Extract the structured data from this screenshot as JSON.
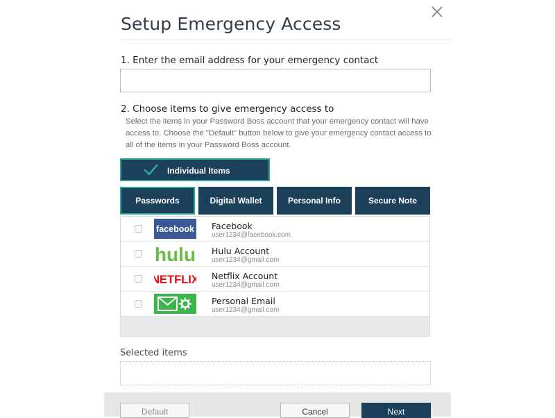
{
  "dialog": {
    "title": "Setup Emergency Access",
    "close_icon": "close-icon"
  },
  "step1": {
    "label": "1. Enter the email address for your emergency contact",
    "email_value": "",
    "email_placeholder": ""
  },
  "step2": {
    "label": "2. Choose items to give emergency access to",
    "description": "Select the items in your Password Boss account that your emergency contact will have access to. Choose the \"Default\" button below to give your emergency contact access to all of the items in your Password Boss account."
  },
  "mode": {
    "label": "Individual Items",
    "icon": "checkmark-icon",
    "selected": true
  },
  "tabs": [
    {
      "label": "Passwords",
      "active": true
    },
    {
      "label": "Digital Wallet",
      "active": false
    },
    {
      "label": "Personal Info",
      "active": false
    },
    {
      "label": "Secure Note",
      "active": false
    }
  ],
  "items": [
    {
      "name": "Facebook",
      "account": "user1234@facebook.com",
      "logo": "facebook",
      "checked": false
    },
    {
      "name": "Hulu Account",
      "account": "user1234@gmail.com",
      "logo": "hulu",
      "checked": false
    },
    {
      "name": "Netflix Account",
      "account": "user1234@gmail.com",
      "logo": "NETFLIX",
      "checked": false
    },
    {
      "name": "Personal Email",
      "account": "user1234@gmail.com",
      "logo": "email-icon",
      "checked": false
    }
  ],
  "selected_items": {
    "label": "Selected items",
    "value": ""
  },
  "footer": {
    "default_label": "Default",
    "cancel_label": "Cancel",
    "next_label": "Next"
  },
  "colors": {
    "primary": "#1c3f5a",
    "accent": "#2aa99b",
    "facebook": "#3b5998",
    "hulu": "#6bbd45",
    "netflix": "#e50914",
    "email": "#3ab54a"
  }
}
